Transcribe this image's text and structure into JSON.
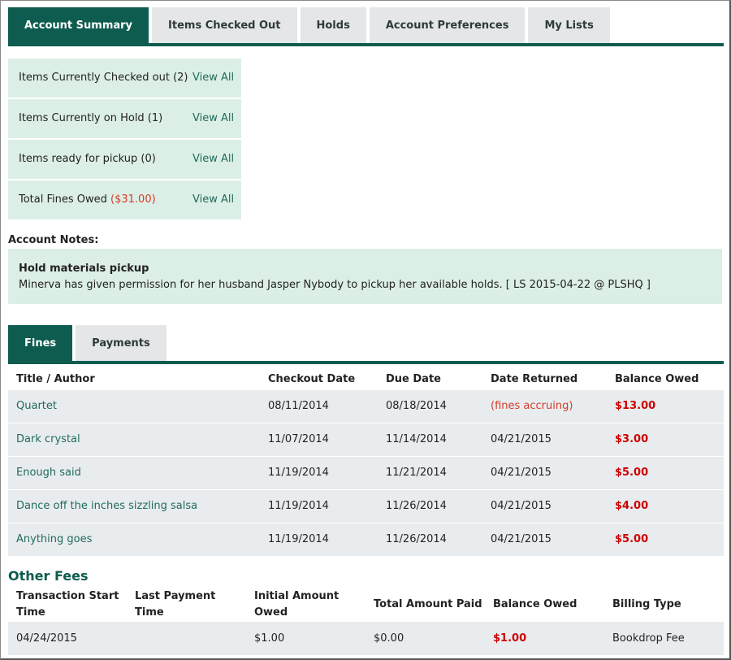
{
  "top_tabs": [
    "Account Summary",
    "Items Checked Out",
    "Holds",
    "Account Preferences",
    "My Lists"
  ],
  "summary": [
    {
      "label": "Items Currently Checked out (2)",
      "link": "View All"
    },
    {
      "label": "Items Currently on Hold (1)",
      "link": "View All"
    },
    {
      "label": "Items ready for pickup (0)",
      "link": "View All"
    },
    {
      "label": "Total Fines Owed ",
      "fine": "($31.00)",
      "link": "View All"
    }
  ],
  "notes": {
    "heading": "Account Notes:",
    "title": "Hold materials pickup",
    "text": "Minerva has given permission for her husband Jasper Nybody to pickup her available holds. [ LS 2015-04-22 @ PLSHQ ]"
  },
  "fine_tabs": [
    "Fines",
    "Payments"
  ],
  "fines": {
    "headers": [
      "Title / Author",
      "Checkout Date",
      "Due Date",
      "Date Returned",
      "Balance Owed"
    ],
    "rows": [
      [
        "Quartet",
        "08/11/2014",
        "08/18/2014",
        "(fines accruing)",
        "$13.00"
      ],
      [
        "Dark crystal",
        "11/07/2014",
        "11/14/2014",
        "04/21/2015",
        "$3.00"
      ],
      [
        "Enough said",
        "11/19/2014",
        "11/21/2014",
        "04/21/2015",
        "$5.00"
      ],
      [
        "Dance off the inches sizzling salsa",
        "11/19/2014",
        "11/26/2014",
        "04/21/2015",
        "$4.00"
      ],
      [
        "Anything goes",
        "11/19/2014",
        "11/26/2014",
        "04/21/2015",
        "$5.00"
      ]
    ]
  },
  "other_fees": {
    "heading": "Other Fees",
    "headers": [
      "Transaction Start Time",
      "Last Payment Time",
      "Initial Amount Owed",
      "Total Amount Paid",
      "Balance Owed",
      "Billing Type"
    ],
    "rows": [
      [
        "04/24/2015",
        "",
        "$1.00",
        "$0.00",
        "$1.00",
        "Bookdrop Fee"
      ]
    ]
  },
  "colors": {
    "accent": "#0e5c4f",
    "panel": "#dcefe6",
    "owed": "#cc0000",
    "link": "#1f6b5a"
  }
}
